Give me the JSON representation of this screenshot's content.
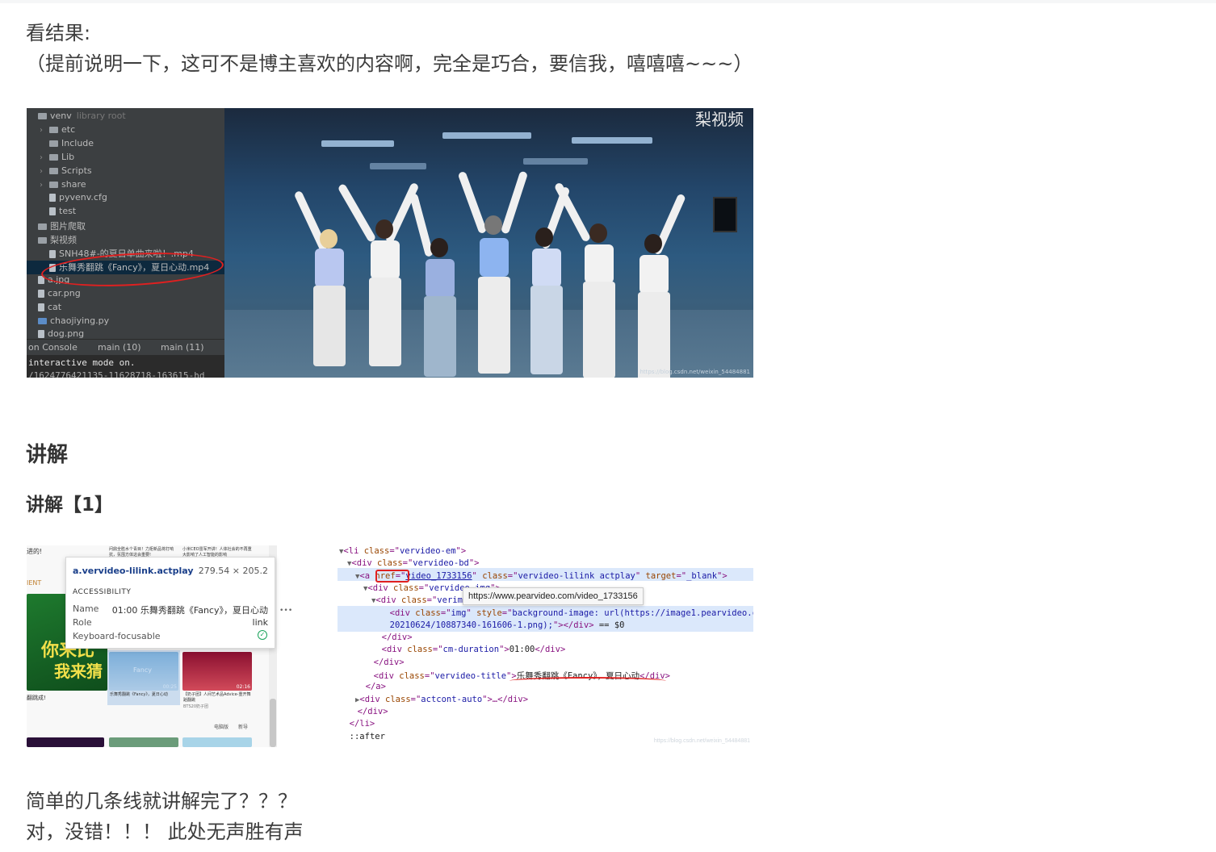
{
  "intro": {
    "line1": "看结果:",
    "line2": "（提前说明一下，这可不是博主喜欢的内容啊，完全是巧合，要信我，嘻嘻嘻~~~）"
  },
  "figure1": {
    "tree": [
      {
        "label": "venv",
        "note": "library root",
        "type": "folder",
        "expand": ""
      },
      {
        "label": "etc",
        "type": "folder",
        "expand": "›"
      },
      {
        "label": "Include",
        "type": "folder",
        "expand": ""
      },
      {
        "label": "Lib",
        "type": "folder",
        "expand": "›"
      },
      {
        "label": "Scripts",
        "type": "folder",
        "expand": "›"
      },
      {
        "label": "share",
        "type": "folder",
        "expand": "›"
      },
      {
        "label": "pyvenv.cfg",
        "type": "file",
        "expand": ""
      },
      {
        "label": "test",
        "type": "file",
        "expand": ""
      },
      {
        "label": "图片爬取",
        "type": "folder",
        "expand": ""
      },
      {
        "label": "梨视频",
        "type": "folder",
        "expand": ""
      },
      {
        "label": "SNH48#-的夏日单曲来啦！.mp4",
        "type": "file",
        "expand": ""
      },
      {
        "label": "乐舞秀翻跳《Fancy》，夏日心动.mp4",
        "type": "file",
        "expand": "",
        "selected": true
      },
      {
        "label": "a.jpg",
        "type": "file",
        "expand": ""
      },
      {
        "label": "car.png",
        "type": "file",
        "expand": ""
      },
      {
        "label": "cat",
        "type": "file",
        "expand": ""
      },
      {
        "label": "chaojiying.py",
        "type": "py",
        "expand": ""
      },
      {
        "label": "dog.png",
        "type": "file",
        "expand": ""
      }
    ],
    "console_tabs": [
      "on Console",
      "main (10)",
      "main (11)"
    ],
    "console_line1": "interactive mode on.",
    "console_line2": "/1624776421135-11628718-163615-hd",
    "video_watermark": "梨视频",
    "video_credit": "https://blog.csdn.net/weixin_54484881"
  },
  "heading_explain": "讲解",
  "heading_explain_1": "讲解【1】",
  "figure2": {
    "tooltip": {
      "selector": "a.vervideo-lilink.actplay",
      "dimensions": "279.54 × 205.2",
      "section": "ACCESSIBILITY",
      "name_label": "Name",
      "name_value": "01:00 乐舞秀翻跳《Fancy》，夏日心动",
      "role_label": "Role",
      "role_value": "link",
      "focus_label": "Keyboard-focusable"
    },
    "site_text": {
      "t1": "进的!",
      "t2": "IENT",
      "t3": "你来比",
      "t4": "我来猜",
      "t5": "翻跳成!",
      "t6": "Fancy",
      "t7": "乐舞秀翻跳《Fancy》，夏日心动",
      "t8": "【奶子团】人间艺术品Advice-重开舞蹈翻跳",
      "t9": "BTS20奶子团",
      "t10": "00:25",
      "t11": "02:16",
      "t12": "电脑版",
      "t13": "新导",
      "t14": "问鼎全胜水个青目！力拒新品将打响抗，氛围方体这会重要!",
      "t15": "小米CEO雷军开讲！人体社会的不再重大影响了人工智能的影响"
    },
    "devtools": [
      {
        "indent": 0,
        "tri": "▼",
        "html": "li"
      },
      {
        "indent": 1,
        "tri": "▼",
        "html": "div-bd"
      },
      {
        "indent": 2,
        "tri": "▼",
        "html": "a"
      },
      {
        "indent": 3,
        "tri": "▼",
        "html": "div-img-wrap"
      },
      {
        "indent": 4,
        "tri": "▼",
        "html": "div-verimg"
      },
      {
        "indent": 5,
        "tri": "",
        "html": "div-img"
      },
      {
        "indent": 5,
        "tri": "",
        "html": "div-img-cont"
      },
      {
        "indent": 4,
        "tri": "",
        "html": "/div"
      },
      {
        "indent": 4,
        "tri": "",
        "html": "duration"
      },
      {
        "indent": 3,
        "tri": "",
        "html": "/div"
      },
      {
        "indent": 3,
        "tri": "",
        "html": "title"
      },
      {
        "indent": 2,
        "tri": "",
        "html": "/a"
      },
      {
        "indent": 2,
        "tri": "▶",
        "html": "actcont"
      },
      {
        "indent": 1,
        "tri": "",
        "html": "/div"
      },
      {
        "indent": 0,
        "tri": "",
        "html": "/li"
      },
      {
        "indent": 0,
        "tri": "",
        "html": "after"
      }
    ],
    "code": {
      "li_class": "vervideo-em",
      "bd_class": "vervideo-bd",
      "a_href": "video_1733156",
      "a_class": "vervideo-lilink actplay",
      "a_target": "_blank",
      "imgwrap_class": "vervideo-img",
      "verimg_class": "verimg-view",
      "img_class": "img",
      "img_style": "background-image: url(https://image1.pearvideo.com/",
      "img_style2": "20210624/10887340-161606-1.png);",
      "img_eq": "== $0",
      "duration_class": "cm-duration",
      "duration_text": "01:00",
      "title_class": "vervideo-title",
      "title_text": "乐舞秀翻跳《Fancy》，夏日心动",
      "act_class": "actcont-auto",
      "after": "::after"
    },
    "url_tooltip": "https://www.pearvideo.com/video_1733156",
    "credit": "https://blog.csdn.net/weixin_54484881"
  },
  "outro": {
    "line1": "简单的几条线就讲解完了？？？",
    "line2": "对，没错！！！ 此处无声胜有声"
  }
}
